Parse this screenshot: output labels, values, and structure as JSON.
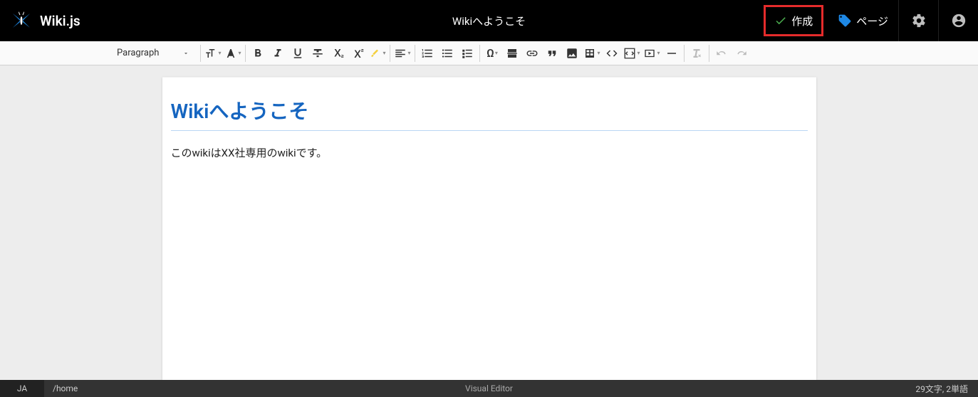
{
  "header": {
    "appName": "Wiki.js",
    "pageTitle": "Wikiへようこそ",
    "createBtn": "作成",
    "pageBtn": "ページ"
  },
  "toolbar": {
    "paragraphLabel": "Paragraph"
  },
  "content": {
    "heading": "Wikiへようこそ",
    "body": "このwikiはXX社専用のwikiです。"
  },
  "status": {
    "lang": "JA",
    "path": "/home",
    "mode": "Visual Editor",
    "stats": "29文字, 2単語"
  }
}
